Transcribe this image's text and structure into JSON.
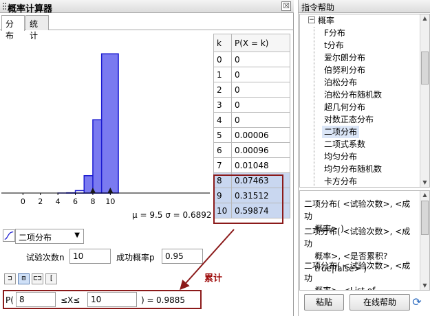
{
  "calculator": {
    "title": "概率计算器",
    "close_glyph": "☒",
    "tabs": [
      {
        "label": "分布",
        "active": true
      },
      {
        "label": "统计",
        "active": false
      }
    ],
    "distribution_select": "二项分布",
    "params": {
      "trials_label": "试验次数n",
      "trials_value": "10",
      "success_label": "成功概率p",
      "success_value": "0.95"
    },
    "interval_buttons": [
      {
        "glyph": "⊐",
        "name": "left-sided-button",
        "active": false
      },
      {
        "glyph": "⊟",
        "name": "interval-button",
        "active": true
      },
      {
        "glyph": "⊏⊐",
        "name": "two-tailed-button",
        "active": false
      },
      {
        "glyph": "[",
        "name": "right-sided-button",
        "active": false
      }
    ],
    "cumulative_label": "累计",
    "probability": {
      "prefix": "P(",
      "lower": "8",
      "middle": "≤X≤",
      "upper": "10",
      "suffix": ") =",
      "result": "0.9885"
    },
    "table": {
      "headers": [
        "k",
        "P(X = k)"
      ],
      "rows": [
        {
          "k": "0",
          "p": "0"
        },
        {
          "k": "1",
          "p": "0"
        },
        {
          "k": "2",
          "p": "0"
        },
        {
          "k": "3",
          "p": "0"
        },
        {
          "k": "4",
          "p": "0"
        },
        {
          "k": "5",
          "p": "0.00006"
        },
        {
          "k": "6",
          "p": "0.00096"
        },
        {
          "k": "7",
          "p": "0.01048"
        },
        {
          "k": "8",
          "p": "0.07463"
        },
        {
          "k": "9",
          "p": "0.31512"
        },
        {
          "k": "10",
          "p": "0.59874"
        }
      ],
      "highlighted_from_k": 8
    }
  },
  "chart_data": {
    "type": "bar",
    "x": [
      0,
      1,
      2,
      3,
      4,
      5,
      6,
      7,
      8,
      9,
      10
    ],
    "values": [
      0,
      0,
      0,
      0,
      0,
      6e-05,
      0.00096,
      0.01048,
      0.07463,
      0.31512,
      0.59874
    ],
    "highlighted_x": [
      8,
      9,
      10
    ],
    "x_ticks": [
      "0",
      "2",
      "4",
      "6",
      "8",
      "10"
    ],
    "xlim": [
      -1,
      11
    ],
    "ylim": [
      0,
      0.65
    ],
    "stats_text": "μ = 9.5   σ = 0.6892",
    "marker_positions_x": [
      8,
      10
    ],
    "colors": {
      "bar_fill": "#7a7af0",
      "bar_stroke": "#1a1ad0",
      "marker": "#1a1a1a"
    }
  },
  "help": {
    "title": "指令帮助",
    "tree_root": "概率",
    "tree_toggle": "−",
    "tree_items": [
      "F分布",
      "t分布",
      "爱尔朗分布",
      "伯努利分布",
      "泊松分布",
      "泊松分布随机数",
      "超几何分布",
      "对数正态分布",
      "二项分布",
      "二项式系数",
      "均匀分布",
      "均匀分布随机数",
      "卡方分布"
    ],
    "tree_selected": "二项分布",
    "syntax_lines": [
      "二项分布( <试验次数>, <成功\n    概率> )",
      "二项分布( <试验次数>, <成功\n    概率>, <是否累积?\n    true|false> )",
      "二项分布( <试验次数>, <成功\n    概率>, <List of"
    ],
    "paste_button": "粘贴",
    "online_help_button": "在线帮助",
    "refresh_glyph": "⟳"
  }
}
